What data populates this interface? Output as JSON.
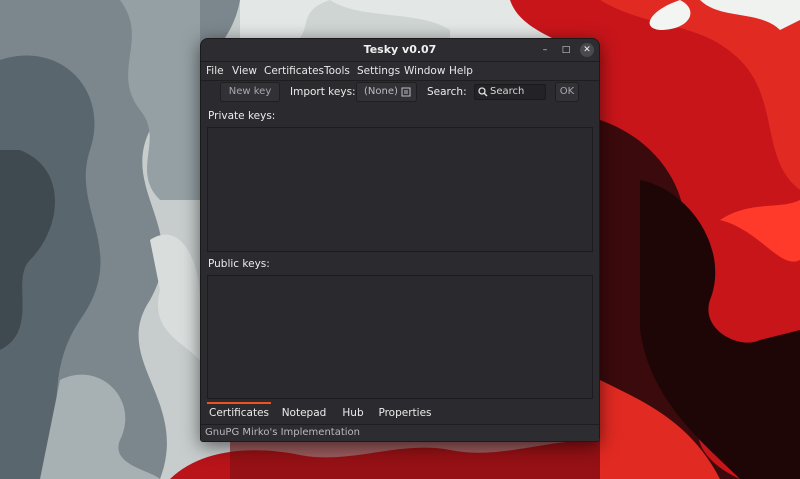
{
  "window": {
    "title": "Tesky v0.07",
    "controls": {
      "minimize_glyph": "–",
      "maximize_glyph": "□",
      "close_glyph": "✕"
    }
  },
  "menu": {
    "items": [
      "File",
      "View",
      "Certificates",
      "Tools",
      "Settings",
      "Window",
      "Help"
    ]
  },
  "toolbar": {
    "new_key_label": "New key",
    "import_keys_label": "Import keys:",
    "import_value": "(None)",
    "import_icon": "file-icon",
    "search_label": "Search:",
    "search_placeholder": "Search",
    "search_icon": "search-icon",
    "ok_label": "OK"
  },
  "sections": {
    "private_keys_label": "Private keys:",
    "public_keys_label": "Public keys:"
  },
  "tabs": {
    "items": [
      "Certificates",
      "Notepad",
      "Hub",
      "Properties"
    ],
    "active": "Certificates",
    "accent_color": "#e95420"
  },
  "status": {
    "text": "GnuPG Mirko's Implementation"
  },
  "colors": {
    "window_bg": "#2b2a2e",
    "wallpaper_red": "#d41a17",
    "wallpaper_grey": "#6f7b82"
  }
}
